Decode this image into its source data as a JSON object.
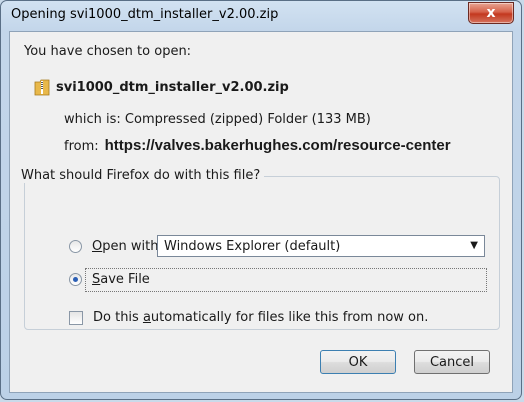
{
  "window": {
    "title": "Opening svi1000_dtm_installer_v2.00.zip",
    "close_label": "x"
  },
  "intro": {
    "text": "You have chosen to open:"
  },
  "file": {
    "icon": "zip-folder-icon",
    "name": "svi1000_dtm_installer_v2.00.zip",
    "which_is_label": "which is:",
    "which_is_value": "Compressed (zipped) Folder (133 MB)",
    "from_label": "from:",
    "from_url": "https://valves.bakerhughes.com/resource-center"
  },
  "action_group": {
    "legend": "What should Firefox do with this file?",
    "open_with": {
      "label_prefix": "",
      "underline": "O",
      "label_rest": "pen with",
      "checked": false
    },
    "open_with_select": {
      "selected": "Windows Explorer (default)"
    },
    "save_file": {
      "underline": "S",
      "label_rest": "ave File",
      "checked": true
    },
    "auto": {
      "prefix": "Do this ",
      "underline": "a",
      "rest": "utomatically for files like this from now on.",
      "checked": false
    }
  },
  "buttons": {
    "ok": "OK",
    "cancel": "Cancel"
  }
}
